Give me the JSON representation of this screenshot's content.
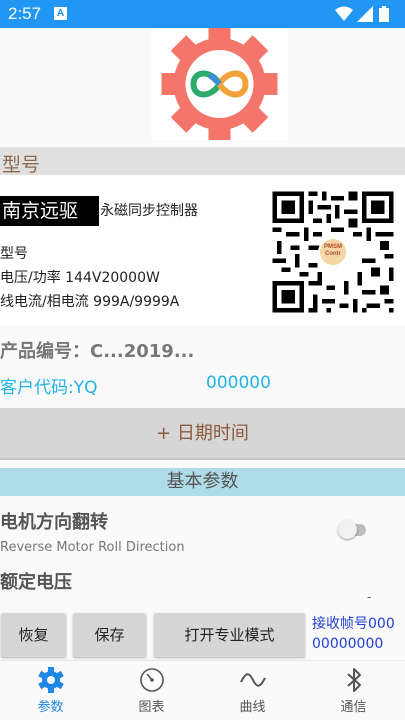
{
  "status_bar": {
    "time": "2:57",
    "app_icon_letter": "A"
  },
  "header": {
    "section_model": "型号"
  },
  "product": {
    "brand": "南京远驱",
    "description": "永磁同步控制器",
    "model_label": "型号",
    "voltage_power": "电压/功率  144V20000W",
    "current": "线电流/相电流  999A/9999A",
    "qr_badge_text": "PMSM Contr"
  },
  "product_number": "产品编号：C...2019...",
  "customer": {
    "code_label": "客户代码:YQ",
    "code_value": "000000"
  },
  "date_button": "+ 日期时间",
  "params_header": "基本参数",
  "params": [
    {
      "title": "电机方向翻转",
      "subtitle": "Reverse Motor Roll Direction"
    },
    {
      "title": "额定电压"
    }
  ],
  "actions": {
    "restore": "恢复",
    "save": "保存",
    "pro_mode": "打开专业模式",
    "frame_label": "接收帧号000 00000000"
  },
  "nav": [
    {
      "label": "参数",
      "icon": "gear-icon",
      "active": true
    },
    {
      "label": "图表",
      "icon": "gauge-icon",
      "active": false
    },
    {
      "label": "曲线",
      "icon": "wave-icon",
      "active": false
    },
    {
      "label": "通信",
      "icon": "bluetooth-icon",
      "active": false
    }
  ],
  "colors": {
    "status_bar": "#2196f3",
    "accent": "#1e88e5",
    "customer": "#22b3e6",
    "params_header": "#aedbe8",
    "logo_gear": "#f4766a"
  }
}
